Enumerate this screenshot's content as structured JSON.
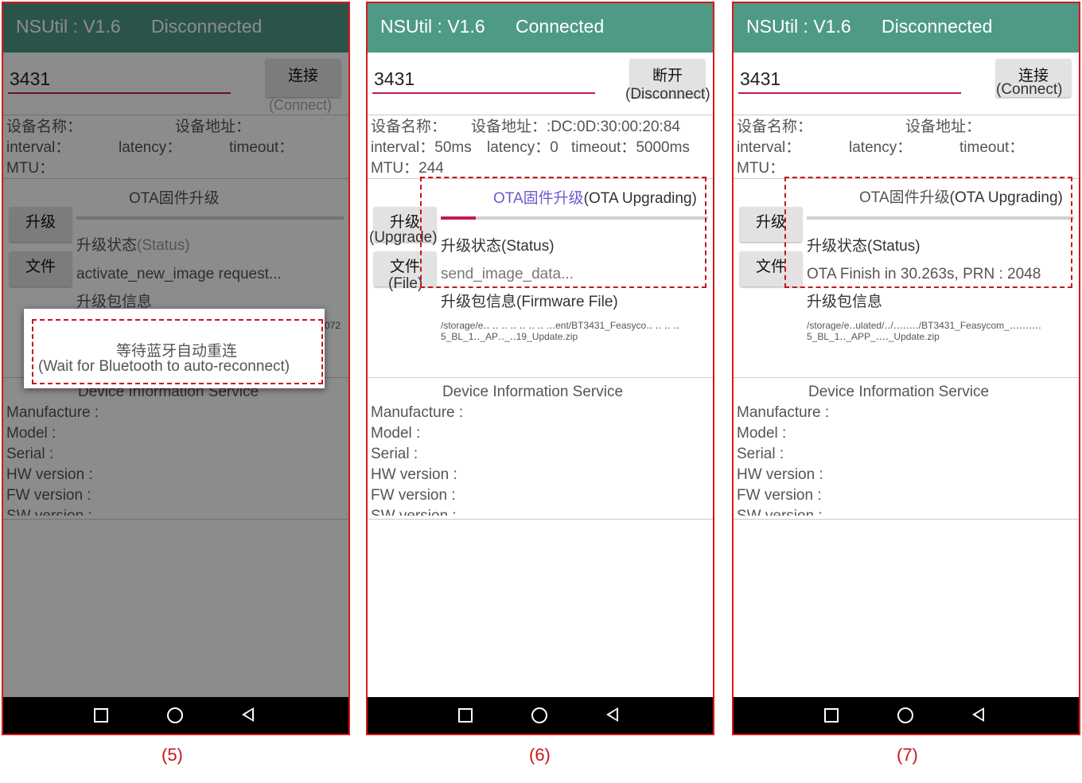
{
  "app": {
    "title": "NSUtil : V1.6",
    "device_input": "3431",
    "labels": {
      "device_name": "设备名称：",
      "device_addr": "设备地址：",
      "interval": "interval：",
      "latency": "latency：",
      "timeout": "timeout：",
      "mtu": "MTU：",
      "ota_title": "OTA固件升级",
      "status_label": "升级状态",
      "package_label": "升级包信息",
      "upgrade_btn": "升级",
      "file_btn": "文件",
      "dis_title": "Device Information Service",
      "manufacture": "Manufacture :",
      "model": "Model :",
      "serial": "Serial :",
      "hw_version": "HW version :",
      "fw_version": "FW version :",
      "sw_version": "SW version :"
    },
    "colors": {
      "appbar": "#4e9a86",
      "accent": "#c2185b",
      "highlight": "#c9151a"
    }
  },
  "screens": {
    "s5": {
      "caption": "(5)",
      "state": "Disconnected",
      "connect_btn": "连接",
      "connect_btn_en": "(Connect)",
      "status_en": "(Status)",
      "status_value": "activate_new_image request...",
      "file_fragment": "072",
      "dialog_line1": "等待蓝牙自动重连",
      "dialog_line2": "(Wait for Bluetooth to auto-reconnect)",
      "progress": 0
    },
    "s6": {
      "caption": "(6)",
      "state": "Connected",
      "connect_btn": "断开",
      "connect_btn_en": "(Disconnect)",
      "device_addr_value": ":DC:0D:30:00:20:84",
      "interval_value": "50ms",
      "latency_value": "0",
      "timeout_value": "5000ms",
      "mtu_value": "244",
      "ota_en": "(OTA Upgrading)",
      "upgrade_en": "(Upgrade)",
      "file_en": "(File)",
      "status_en": "(Status)",
      "status_value": "send_image_data...",
      "package_en": "(Firmware File)",
      "file_path_1": "/storage/e‥ ‥ ‥ ‥ ‥ ‥ ‥ .‥ent/BT3431_Feasyco‥ ‥ ‥ ‥",
      "file_path_2": "5_BL_1‥_AP‥_‥19_Update.zip",
      "progress": 0.13
    },
    "s7": {
      "caption": "(7)",
      "state": "Disconnected",
      "connect_btn": "连接",
      "connect_btn_en": "(Connect)",
      "ota_en": "(OTA Upgrading)",
      "status_en": "(Status)",
      "status_value": "OTA Finish in 30.263s, PRN : 2048",
      "file_path_1": "/storage/e‥ulated/‥/‥‥‥‥/BT3431_Feasycom_‥‥‥‥‥",
      "file_path_2": "5_BL_1‥_APP_‥‥_Update.zip",
      "progress": 1
    }
  }
}
